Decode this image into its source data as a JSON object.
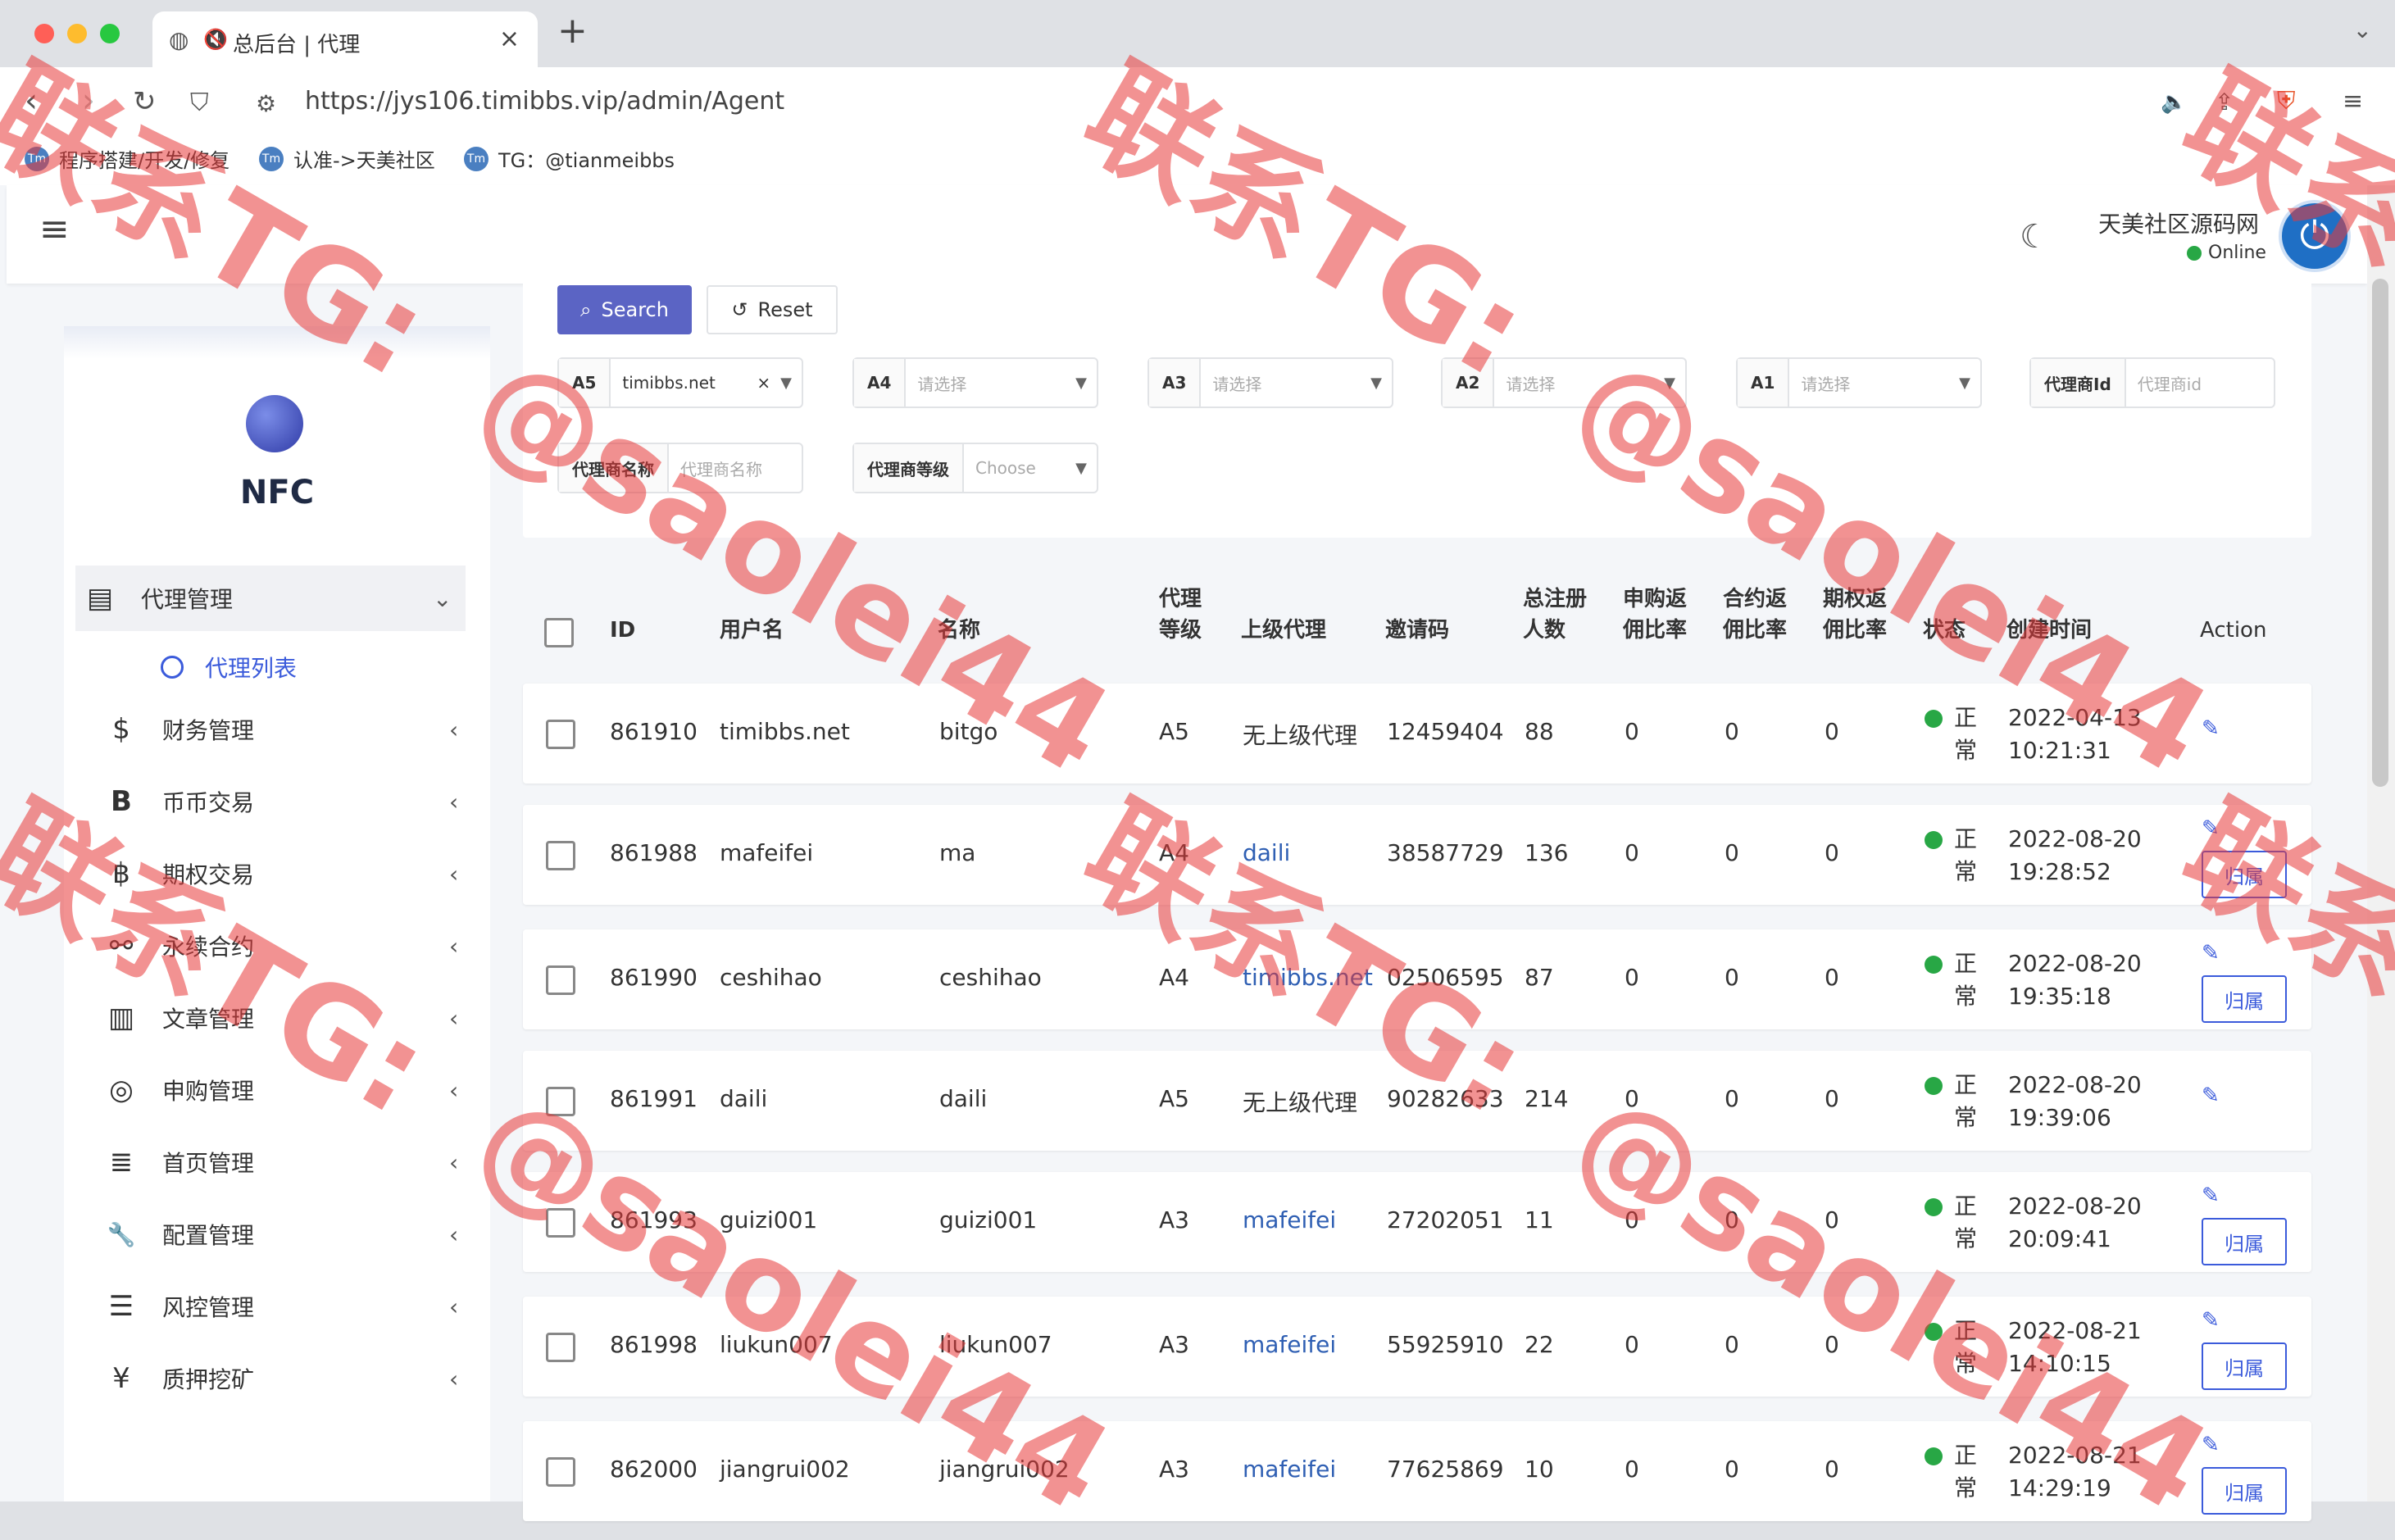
{
  "browser": {
    "tab_title": "总后台 | 代理",
    "url": "https://jys106.timibbs.vip/admin/Agent",
    "bookmarks": [
      "程序搭建/开发/修复",
      "认准->天美社区",
      "TG：@tianmeibbs"
    ]
  },
  "header": {
    "username": "天美社区源码网",
    "status": "Online"
  },
  "sidebar": {
    "brand": "NFC",
    "items": [
      {
        "icon": "id-card-icon",
        "label": "代理管理",
        "glyph": "▤"
      },
      {
        "icon": "dollar-icon",
        "label": "财务管理",
        "glyph": "$"
      },
      {
        "icon": "bitcoin-icon",
        "label": "币币交易",
        "glyph": "B"
      },
      {
        "icon": "bitcoin-small-icon",
        "label": "期权交易",
        "glyph": "฿"
      },
      {
        "icon": "link-icon",
        "label": "永续合约",
        "glyph": "⚯"
      },
      {
        "icon": "newspaper-icon",
        "label": "文章管理",
        "glyph": "▥"
      },
      {
        "icon": "lifebuoy-icon",
        "label": "申购管理",
        "glyph": "◎"
      },
      {
        "icon": "list-icon",
        "label": "首页管理",
        "glyph": "≣"
      },
      {
        "icon": "wrench-icon",
        "label": "配置管理",
        "glyph": "🔧"
      },
      {
        "icon": "indent-icon",
        "label": "风控管理",
        "glyph": "☰"
      },
      {
        "icon": "yen-icon",
        "label": "质押挖矿",
        "glyph": "¥"
      }
    ],
    "subitem": "代理列表"
  },
  "filters": {
    "search_label": "Search",
    "reset_label": "Reset",
    "a5": {
      "label": "A5",
      "value": "timibbs.net"
    },
    "a4": {
      "label": "A4",
      "placeholder": "请选择"
    },
    "a3": {
      "label": "A3",
      "placeholder": "请选择"
    },
    "a2": {
      "label": "A2",
      "placeholder": "请选择"
    },
    "a1": {
      "label": "A1",
      "placeholder": "请选择"
    },
    "agent_id": {
      "label": "代理商Id",
      "placeholder": "代理商id"
    },
    "agent_name": {
      "label": "代理商名称",
      "placeholder": "代理商名称"
    },
    "agent_level": {
      "label": "代理商等级",
      "placeholder": "Choose"
    }
  },
  "table": {
    "headers": {
      "id": "ID",
      "username": "用户名",
      "name": "名称",
      "level_1": "代理",
      "level_2": "等级",
      "parent": "上级代理",
      "invite": "邀请码",
      "total_1": "总注册",
      "total_2": "人数",
      "sub_1": "申购返",
      "sub_2": "佣比率",
      "contract_1": "合约返",
      "contract_2": "佣比率",
      "option_1": "期权返",
      "option_2": "佣比率",
      "status": "状态",
      "created": "创建时间",
      "action": "Action"
    },
    "belong_label": "归属",
    "rows": [
      {
        "id": "861910",
        "username": "timibbs.net",
        "name": "bitgo",
        "level": "A5",
        "parent": "无上级代理",
        "parent_link": false,
        "invite": "12459404",
        "total": "88",
        "sub": "0",
        "contract": "0",
        "option": "0",
        "status_1": "正",
        "status_2": "常",
        "date": "2022-04-13",
        "time": "10:21:31",
        "belong": false
      },
      {
        "id": "861988",
        "username": "mafeifei",
        "name": "ma",
        "level": "A4",
        "parent": "daili",
        "parent_link": true,
        "invite": "38587729",
        "total": "136",
        "sub": "0",
        "contract": "0",
        "option": "0",
        "status_1": "正",
        "status_2": "常",
        "date": "2022-08-20",
        "time": "19:28:52",
        "belong": true
      },
      {
        "id": "861990",
        "username": "ceshihao",
        "name": "ceshihao",
        "level": "A4",
        "parent": "timibbs.net",
        "parent_link": true,
        "invite": "02506595",
        "total": "87",
        "sub": "0",
        "contract": "0",
        "option": "0",
        "status_1": "正",
        "status_2": "常",
        "date": "2022-08-20",
        "time": "19:35:18",
        "belong": true
      },
      {
        "id": "861991",
        "username": "daili",
        "name": "daili",
        "level": "A5",
        "parent": "无上级代理",
        "parent_link": false,
        "invite": "90282633",
        "total": "214",
        "sub": "0",
        "contract": "0",
        "option": "0",
        "status_1": "正",
        "status_2": "常",
        "date": "2022-08-20",
        "time": "19:39:06",
        "belong": false
      },
      {
        "id": "861993",
        "username": "guizi001",
        "name": "guizi001",
        "level": "A3",
        "parent": "mafeifei",
        "parent_link": true,
        "invite": "27202051",
        "total": "11",
        "sub": "0",
        "contract": "0",
        "option": "0",
        "status_1": "正",
        "status_2": "常",
        "date": "2022-08-20",
        "time": "20:09:41",
        "belong": true
      },
      {
        "id": "861998",
        "username": "liukun007",
        "name": "liukun007",
        "level": "A3",
        "parent": "mafeifei",
        "parent_link": true,
        "invite": "55925910",
        "total": "22",
        "sub": "0",
        "contract": "0",
        "option": "0",
        "status_1": "正",
        "status_2": "常",
        "date": "2022-08-21",
        "time": "14:10:15",
        "belong": true
      },
      {
        "id": "862000",
        "username": "jiangrui002",
        "name": "jiangrui002",
        "level": "A3",
        "parent": "mafeifei",
        "parent_link": true,
        "invite": "77625869",
        "total": "10",
        "sub": "0",
        "contract": "0",
        "option": "0",
        "status_1": "正",
        "status_2": "常",
        "date": "2022-08-21",
        "time": "14:29:19",
        "belong": true
      }
    ]
  },
  "watermark": {
    "line1": "联系TG:",
    "line2": "@saolei44",
    "fragment": "联系"
  },
  "colors": {
    "accent": "#5b64c4",
    "link": "#2f5fb3",
    "status_ok": "#28a745",
    "watermark": "#e83838"
  }
}
